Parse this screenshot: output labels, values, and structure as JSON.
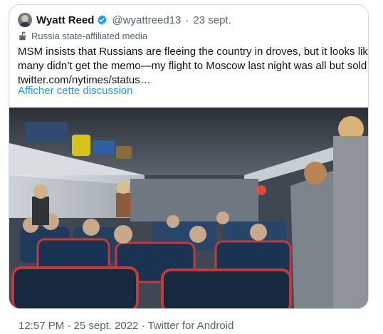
{
  "tweet": {
    "author_name": "Wyatt Reed",
    "handle": "@wyattreed13",
    "separator": "·",
    "date": "23 sept.",
    "label": "Russia state-affiliated media",
    "text_lines": [
      "MSM insists that Russians are fleeing the country in droves, but it looks like",
      "many didn’t get the memo—my flight to Moscow last night was all but sold out.",
      "twitter.com/nytimes/status…"
    ],
    "thread_link": "Afficher cette discussion",
    "timestamp": "12:57 PM · 25 sept. 2022 · Twitter for Android",
    "media_alt": "photo of a crowded airplane cabin"
  },
  "icons": {
    "verified": "verified-badge-icon",
    "state_media": "podium-icon"
  },
  "colors": {
    "link": "#1d9bf0",
    "verified": "#1d9bf0",
    "secondary_text": "#536471",
    "border": "#cfd9de"
  }
}
